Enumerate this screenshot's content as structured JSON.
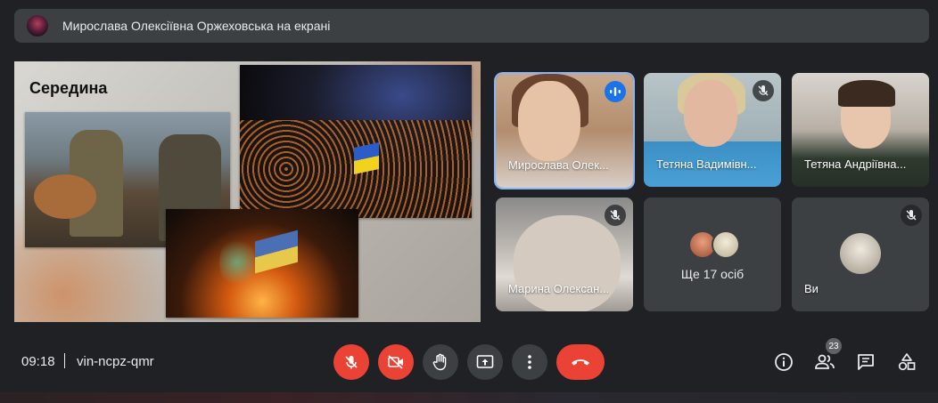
{
  "banner": {
    "text": "Мирослава Олексіївна Оржеховська на екрані"
  },
  "presentation": {
    "title": "Середина"
  },
  "participants": [
    {
      "name": "Мирослава Олек...",
      "status": "speaking"
    },
    {
      "name": "Тетяна Вадимівн...",
      "status": "muted"
    },
    {
      "name": "Тетяна Андріївна...",
      "status": "muted"
    },
    {
      "name": "Марина Олексан...",
      "status": "muted"
    },
    {
      "more": "Ще 17 осіб"
    },
    {
      "name": "Ви",
      "status": "muted"
    }
  ],
  "footer": {
    "time": "09:18",
    "meeting_code": "vin-ncpz-qmr",
    "people_count": "23"
  },
  "colors": {
    "background": "#202124",
    "tile": "#3c4043",
    "red": "#ea4335",
    "blue": "#1a73e8"
  }
}
